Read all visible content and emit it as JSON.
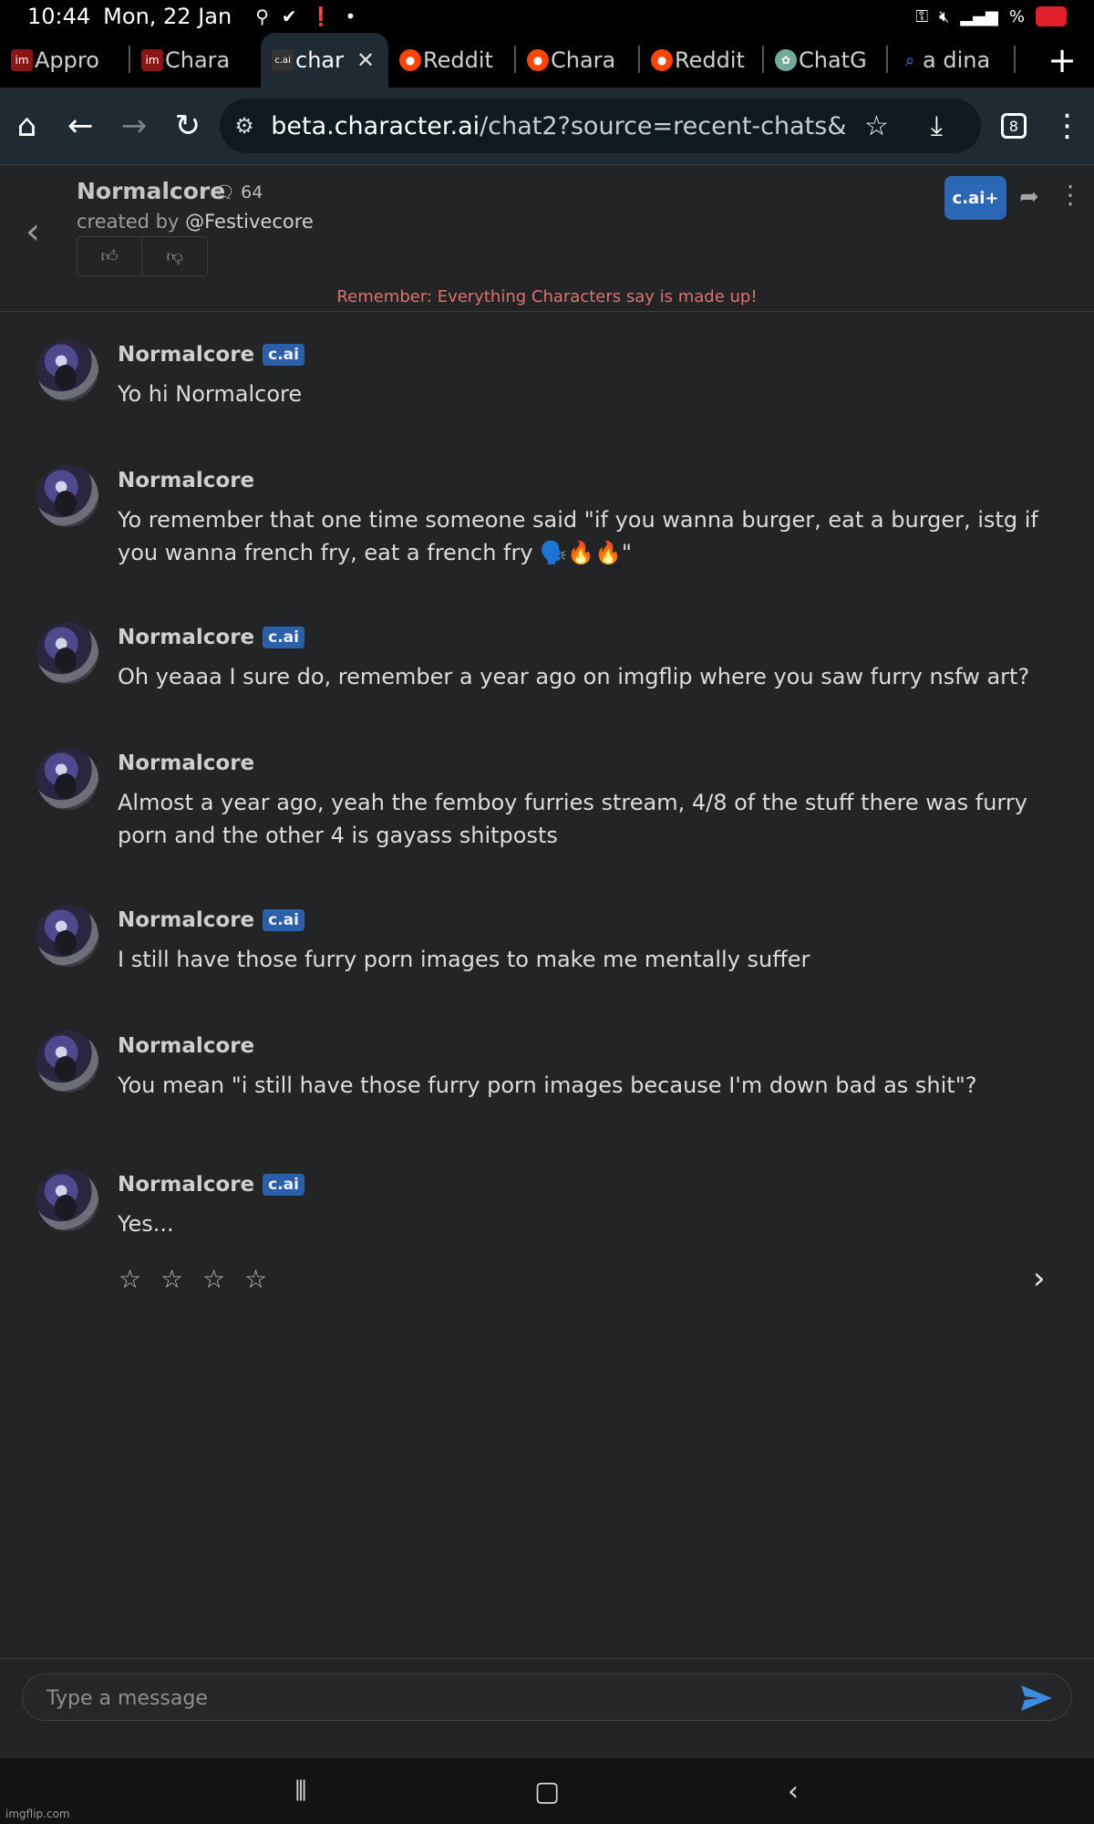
{
  "status_bar": {
    "time": "10:44",
    "date": "Mon, 22 Jan",
    "battery_text": "%"
  },
  "browser": {
    "tabs": [
      {
        "label": "Appro",
        "favicon": "im",
        "favicon_color": "#c21d1d"
      },
      {
        "label": "Chara",
        "favicon": "im",
        "favicon_color": "#c21d1d"
      },
      {
        "label": "char",
        "favicon": "c.ai",
        "favicon_color": "#333333",
        "active": true
      },
      {
        "label": "Reddit",
        "favicon": "reddit",
        "favicon_color": "#ff4500"
      },
      {
        "label": "Chara",
        "favicon": "reddit",
        "favicon_color": "#ff4500"
      },
      {
        "label": "Reddit",
        "favicon": "reddit",
        "favicon_color": "#ff4500"
      },
      {
        "label": "ChatG",
        "favicon": "chatgpt",
        "favicon_color": "#74aa9c"
      },
      {
        "label": "a dina",
        "favicon": "search",
        "favicon_color": "#4285f4"
      }
    ],
    "url_host": "beta.character.ai",
    "url_path": "/chat2?source=recent-chats&",
    "tab_count": "8"
  },
  "chat_header": {
    "character_name": "Normalcore",
    "message_count": "64",
    "created_by_label": "created by ",
    "creator_handle": "@Festivecore",
    "plus_button": "c.ai+",
    "disclaimer": "Remember: Everything Characters say is made up!"
  },
  "messages": [
    {
      "name": "Normalcore",
      "badge": "c.ai",
      "text": "Yo hi Normalcore"
    },
    {
      "name": "Normalcore",
      "badge": "",
      "text": "Yo remember that one time someone said \"if you wanna burger, eat a burger, istg if you wanna french fry, eat a french fry 🗣️🔥🔥\""
    },
    {
      "name": "Normalcore",
      "badge": "c.ai",
      "text": "Oh yeaaa I sure do, remember a year ago on imgflip where you saw furry nsfw art?"
    },
    {
      "name": "Normalcore",
      "badge": "",
      "text": "Almost a year ago, yeah the femboy furries stream, 4/8 of the stuff there was furry porn and the other 4 is gayass shitposts"
    },
    {
      "name": "Normalcore",
      "badge": "c.ai",
      "text": "I still have those furry porn images to make me mentally suffer"
    },
    {
      "name": "Normalcore",
      "badge": "",
      "text": "You mean \"i still have those furry porn images because I'm down bad as shit\"?"
    },
    {
      "name": "Normalcore",
      "badge": "c.ai",
      "text": "Yes..."
    }
  ],
  "rating": {
    "stars": "☆ ☆ ☆ ☆",
    "filled": 0,
    "max": 4
  },
  "composer": {
    "placeholder": "Type a message"
  },
  "watermark": "imgflip.com",
  "colors": {
    "accent": "#2c67b5",
    "disclaimer": "#e07070",
    "background": "#232425"
  }
}
